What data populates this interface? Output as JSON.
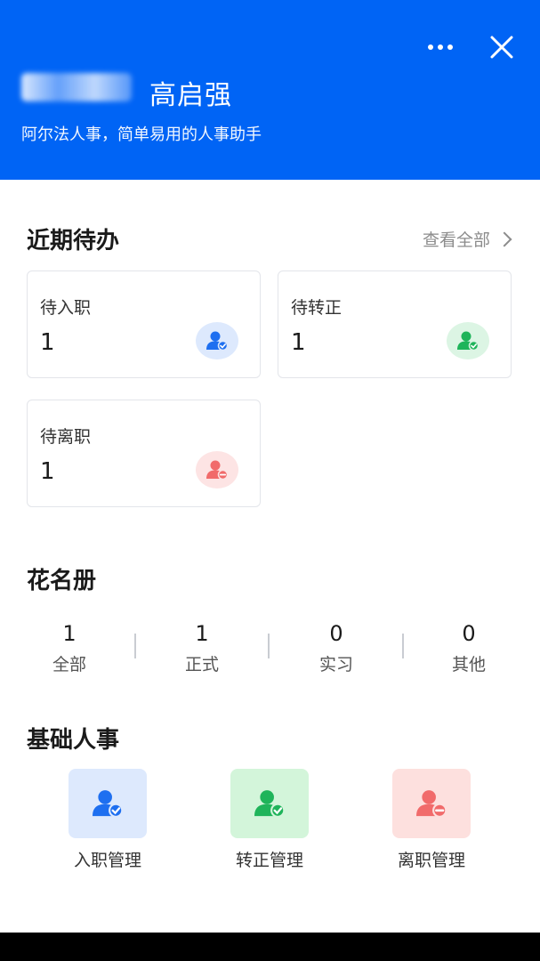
{
  "header": {
    "user_name": "高启强",
    "slogan": "阿尔法人事，简单易用的人事助手"
  },
  "todo": {
    "title": "近期待办",
    "view_all": "查看全部",
    "cards": [
      {
        "label": "待入职",
        "value": "1",
        "icon": "user-check-icon",
        "color": "#1e6ff0",
        "bg": "#dde9fd"
      },
      {
        "label": "待转正",
        "value": "1",
        "icon": "user-check-icon",
        "color": "#1fb45a",
        "bg": "#dcf5e4"
      },
      {
        "label": "待离职",
        "value": "1",
        "icon": "user-minus-icon",
        "color": "#f16b6b",
        "bg": "#fde4e4"
      }
    ]
  },
  "roster": {
    "title": "花名册",
    "items": [
      {
        "value": "1",
        "label": "全部"
      },
      {
        "value": "1",
        "label": "正式"
      },
      {
        "value": "0",
        "label": "实习"
      },
      {
        "value": "0",
        "label": "其他"
      }
    ]
  },
  "basic": {
    "title": "基础人事",
    "tiles": [
      {
        "label": "入职管理",
        "icon": "user-check-icon",
        "color": "#1e6ff0",
        "bg": "#dde9fd"
      },
      {
        "label": "转正管理",
        "icon": "user-check-icon",
        "color": "#1fb45a",
        "bg": "#d3f5da"
      },
      {
        "label": "离职管理",
        "icon": "user-minus-icon",
        "color": "#f16b6b",
        "bg": "#fde0de"
      }
    ]
  },
  "colors": {
    "header_bg": "#0064f5"
  }
}
